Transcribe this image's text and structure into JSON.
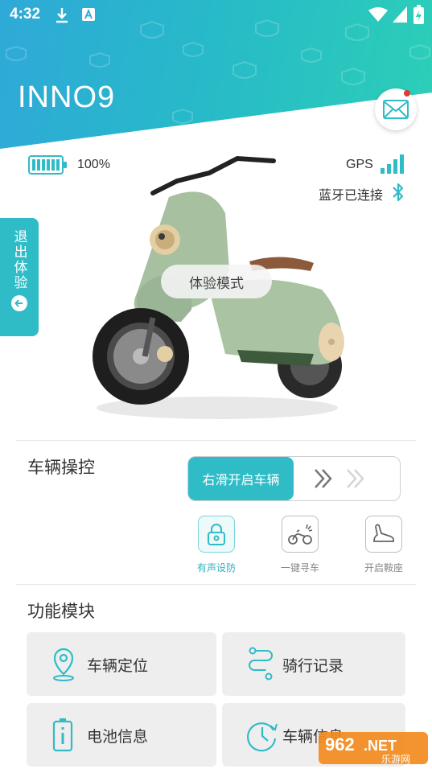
{
  "status_bar": {
    "time": "4:32"
  },
  "header": {
    "title": "INNO9",
    "gradient_start": "#2fa9d8",
    "gradient_end": "#2ccfb7"
  },
  "vehicle_status": {
    "battery_percent": "100%",
    "gps_label": "GPS",
    "bluetooth_label": "蓝牙已连接"
  },
  "experience": {
    "mode_label": "体验模式",
    "exit_label": "退出体验"
  },
  "control": {
    "section_title": "车辆操控",
    "slider_label": "右滑开启车辆",
    "buttons": [
      {
        "label": "有声设防",
        "icon": "lock-icon",
        "active": true
      },
      {
        "label": "一键寻车",
        "icon": "find-scooter-icon",
        "active": false
      },
      {
        "label": "开启鞍座",
        "icon": "seat-icon",
        "active": false
      }
    ]
  },
  "functions": {
    "section_title": "功能模块",
    "tiles": [
      {
        "label": "车辆定位",
        "icon": "location-pin-icon"
      },
      {
        "label": "骑行记录",
        "icon": "route-icon"
      },
      {
        "label": "电池信息",
        "icon": "battery-info-icon"
      },
      {
        "label": "车辆信息",
        "icon": "clock-icon"
      }
    ]
  },
  "watermark": {
    "brand": "962.NET",
    "sub": "乐游网"
  },
  "colors": {
    "accent": "#2fbcc7",
    "tile_bg": "#eeeeee"
  }
}
